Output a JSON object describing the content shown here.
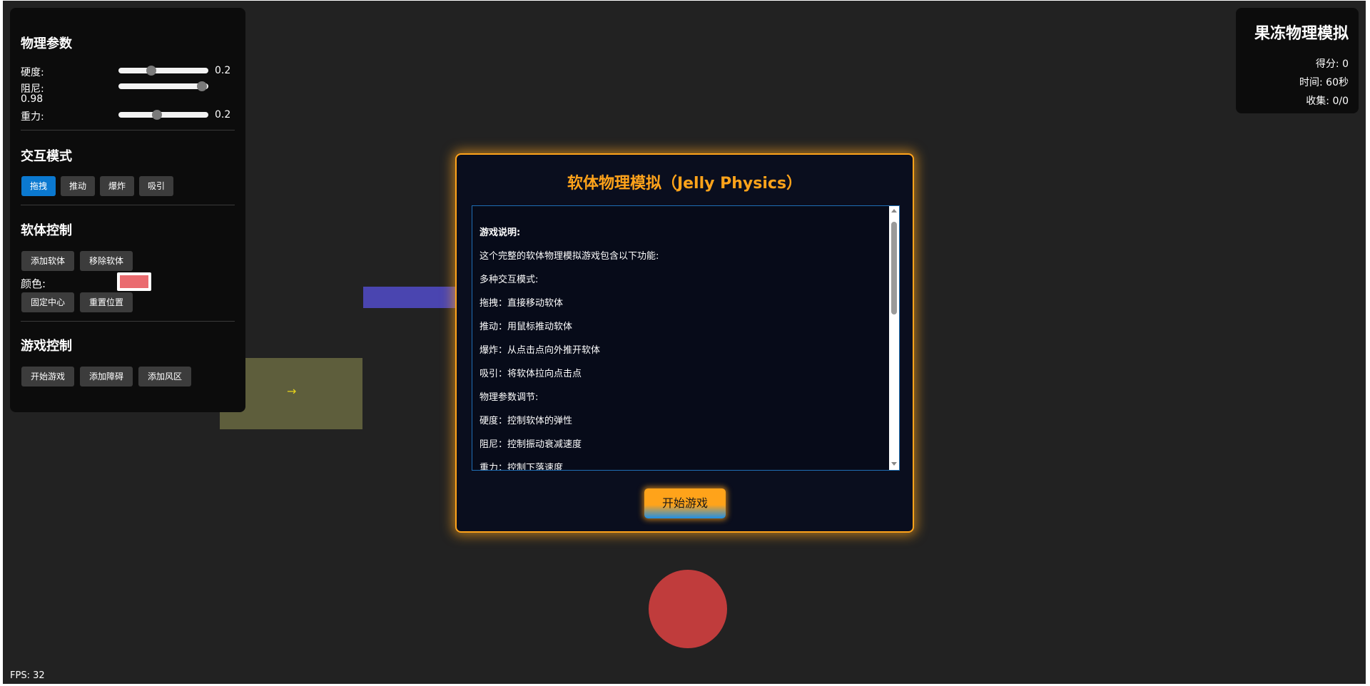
{
  "physics_params": {
    "title": "物理参数",
    "stiffness_label": "硬度:",
    "stiffness_value": "0.2",
    "stiffness_level": 0.35,
    "damping_label": "阻尼:",
    "damping_value": "0.98",
    "damping_level": 0.98,
    "gravity_label": "重力:",
    "gravity_value": "0.2",
    "gravity_level": 0.42
  },
  "interaction_mode": {
    "title": "交互模式",
    "modes": [
      "拖拽",
      "推动",
      "爆炸",
      "吸引"
    ],
    "active_mode": "拖拽"
  },
  "softbody_control": {
    "title": "软体控制",
    "add_label": "添加软体",
    "remove_label": "移除软体",
    "color_label": "颜色:",
    "color_value": "#ea6b6f",
    "fix_center_label": "固定中心",
    "reset_position_label": "重置位置"
  },
  "game_control": {
    "title": "游戏控制",
    "start_label": "开始游戏",
    "add_obstacle_label": "添加障碍",
    "add_wind_label": "添加风区"
  },
  "info": {
    "title": "果冻物理模拟",
    "score": "得分: 0",
    "time": "时间: 60秒",
    "collected": "收集: 0/0"
  },
  "modal": {
    "title": "软体物理模拟（Jelly Physics）",
    "instructions": [
      "游戏说明:",
      "这个完整的软体物理模拟游戏包含以下功能:",
      "多种交互模式:",
      "拖拽：直接移动软体",
      "推动：用鼠标推动软体",
      "爆炸：从点击点向外推开软体",
      "吸引：将软体拉向点击点",
      "物理参数调节:",
      "硬度：控制软体的弹性",
      "阻尼：控制振动衰减速度",
      "重力：控制下落速度"
    ],
    "start_button": "开始游戏"
  },
  "scene": {
    "wind_arrow": "→"
  },
  "fps": "FPS: 32",
  "colors": {
    "accent": "#ffa31a",
    "active_mode": "#0b79d0",
    "jelly": "#c03c3c",
    "background": "#222222"
  }
}
